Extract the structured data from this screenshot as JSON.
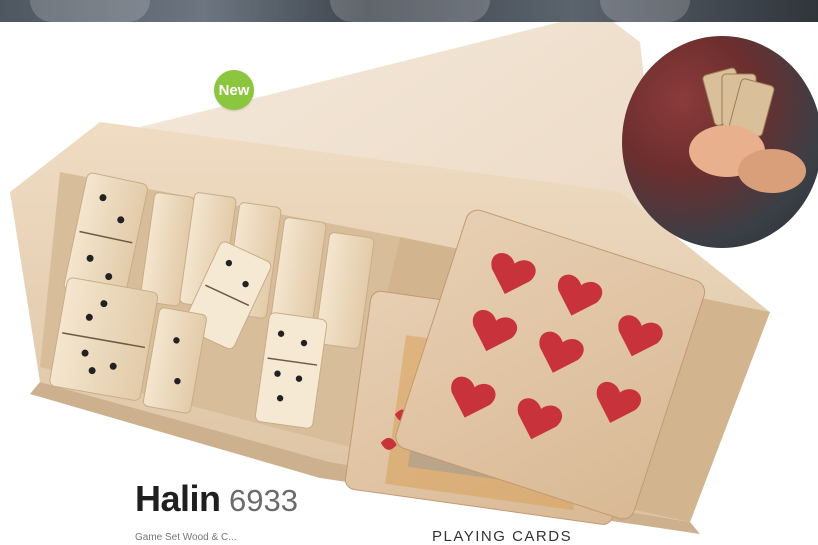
{
  "badge": {
    "label": "New"
  },
  "product": {
    "name": "Halin",
    "number": "6933",
    "subtitle": "Game Set Wood & C...",
    "category": "PLAYING CARDS"
  },
  "images": {
    "product_photo": "wooden box with dominoes and playing cards",
    "inset_photo": "hands holding playing cards"
  },
  "colors": {
    "badge_green": "#8cc63f",
    "title": "#1f1f1f",
    "number": "#6b6b6b",
    "card_red": "#c8323a",
    "wood": "#e9d6bd"
  }
}
